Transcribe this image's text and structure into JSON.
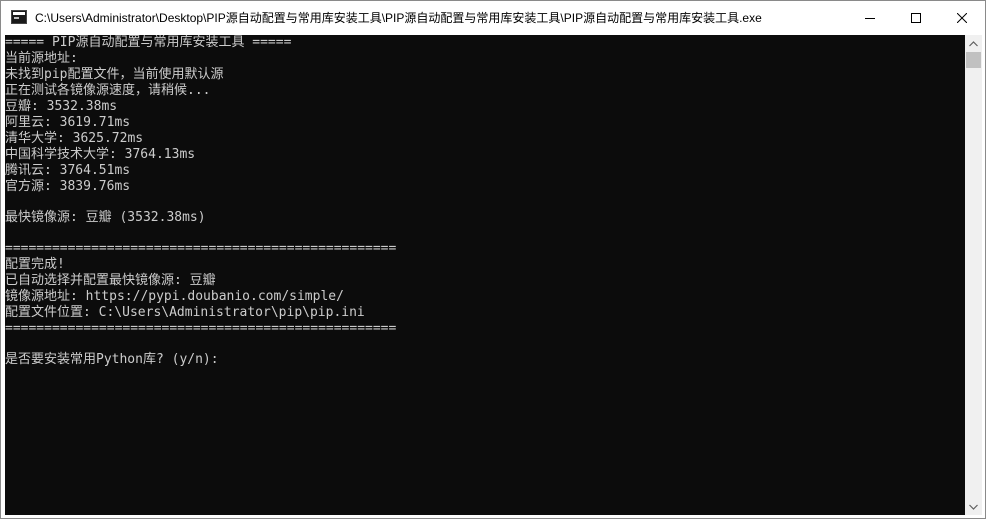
{
  "window": {
    "title": "C:\\Users\\Administrator\\Desktop\\PIP源自动配置与常用库安装工具\\PIP源自动配置与常用库安装工具\\PIP源自动配置与常用库安装工具.exe",
    "icon": "console-app-icon",
    "controls": {
      "minimize": "minimize-icon",
      "maximize": "maximize-icon",
      "close": "close-icon"
    }
  },
  "console": {
    "background": "#0c0c0c",
    "foreground": "#cccccc",
    "lines": [
      "===== PIP源自动配置与常用库安装工具 =====",
      "当前源地址:",
      "未找到pip配置文件，当前使用默认源",
      "正在测试各镜像源速度，请稍候...",
      "豆瓣: 3532.38ms",
      "阿里云: 3619.71ms",
      "清华大学: 3625.72ms",
      "中国科学技术大学: 3764.13ms",
      "腾讯云: 3764.51ms",
      "官方源: 3839.76ms",
      "",
      "最快镜像源: 豆瓣 (3532.38ms)",
      "",
      "==================================================",
      "配置完成!",
      "已自动选择并配置最快镜像源: 豆瓣",
      "镜像源地址: https://pypi.doubanio.com/simple/",
      "配置文件位置: C:\\Users\\Administrator\\pip\\pip.ini",
      "==================================================",
      "",
      "是否要安装常用Python库? (y/n):"
    ]
  },
  "scrollbar": {
    "up": "scroll-up-arrow-icon",
    "down": "scroll-down-arrow-icon"
  }
}
